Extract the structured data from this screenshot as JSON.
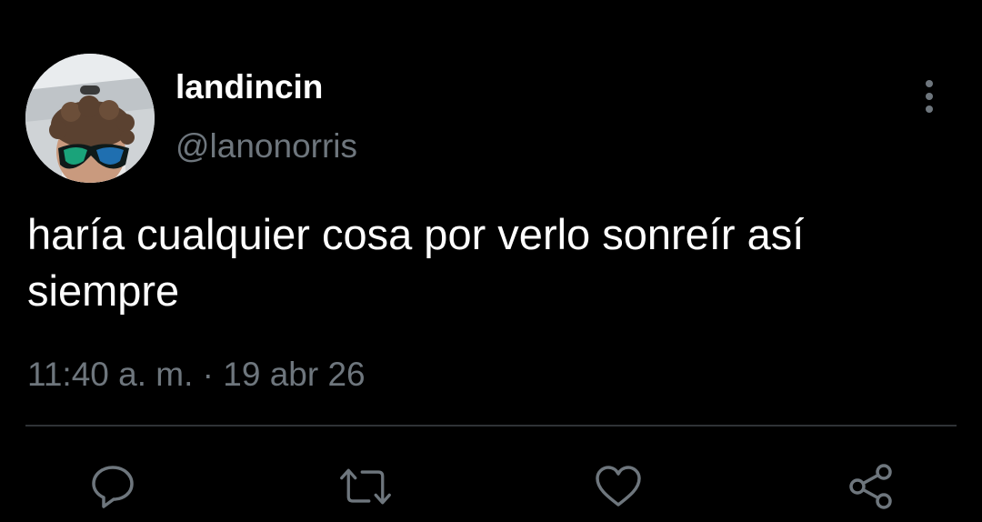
{
  "tweet": {
    "display_name": "landincin",
    "handle": "@lanonorris",
    "text": "haría cualquier cosa por verlo sonreír así siempre",
    "time": "11:40 a. m.",
    "separator": "·",
    "date": "19 abr 26"
  },
  "avatar": {
    "description_icon": "profile-photo"
  },
  "actions": [
    {
      "name": "reply",
      "icon": "speech-bubble-icon"
    },
    {
      "name": "retweet",
      "icon": "retweet-arrows-icon"
    },
    {
      "name": "like",
      "icon": "heart-icon"
    },
    {
      "name": "share",
      "icon": "share-nodes-icon"
    }
  ],
  "colors": {
    "background": "#000000",
    "primary_text": "#ffffff",
    "secondary_text": "#6e767d",
    "divider": "#2f3336",
    "icon": "#6e767d"
  }
}
